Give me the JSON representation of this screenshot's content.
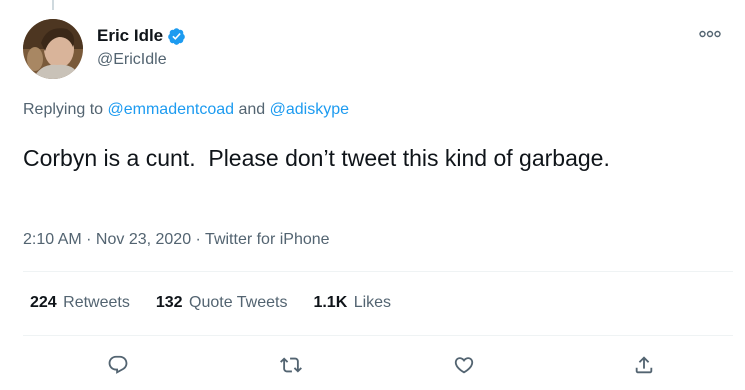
{
  "author": {
    "display_name": "Eric Idle",
    "handle": "@EricIdle",
    "verified": true
  },
  "replying": {
    "prefix": "Replying to ",
    "users": [
      "@emmadentcoad",
      "@adiskype"
    ],
    "conjunction": " and "
  },
  "tweet": {
    "text": "Corbyn is a cunt.  Please don’t tweet this kind of garbage."
  },
  "meta": {
    "time": "2:10 AM",
    "separator": " · ",
    "date": "Nov 23, 2020",
    "source": "Twitter for iPhone"
  },
  "stats": {
    "retweets_count": "224",
    "retweets_label": "Retweets",
    "quotes_count": "132",
    "quotes_label": "Quote Tweets",
    "likes_count": "1.1K",
    "likes_label": "Likes"
  },
  "actions": [
    "reply-icon",
    "retweet-icon",
    "like-icon",
    "share-icon"
  ],
  "colors": {
    "accent": "#1d9bf0",
    "text": "#0f1419",
    "secondary": "#536471",
    "divider": "#eff3f4"
  }
}
